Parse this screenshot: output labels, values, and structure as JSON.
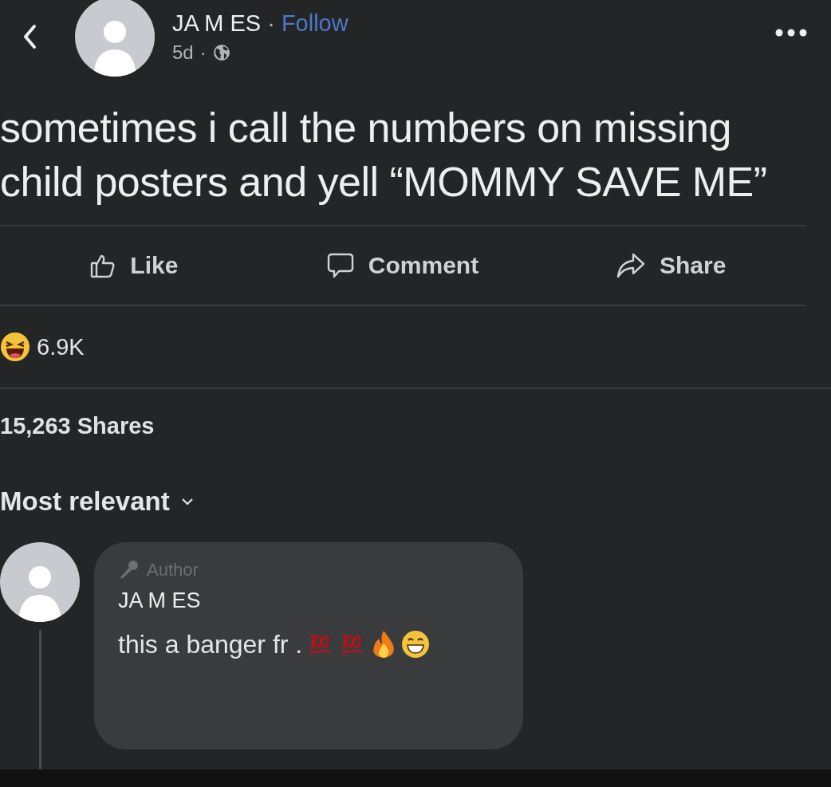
{
  "post": {
    "author": "JA M ES",
    "separator": "·",
    "follow": "Follow",
    "time": "5d",
    "time_separator": "·",
    "text": "sometimes i call the numbers on missing child posters and yell “MOMMY SAVE ME”"
  },
  "actions": [
    {
      "kind": "like",
      "label": "Like"
    },
    {
      "kind": "comment",
      "label": "Comment"
    },
    {
      "kind": "share",
      "label": "Share"
    }
  ],
  "reactions": {
    "count": "6.9K"
  },
  "shares": "15,263 Shares",
  "sort": {
    "label": "Most relevant"
  },
  "comment": {
    "badge": "Author",
    "author": "JA M ES",
    "text": "this a banger fr ."
  }
}
